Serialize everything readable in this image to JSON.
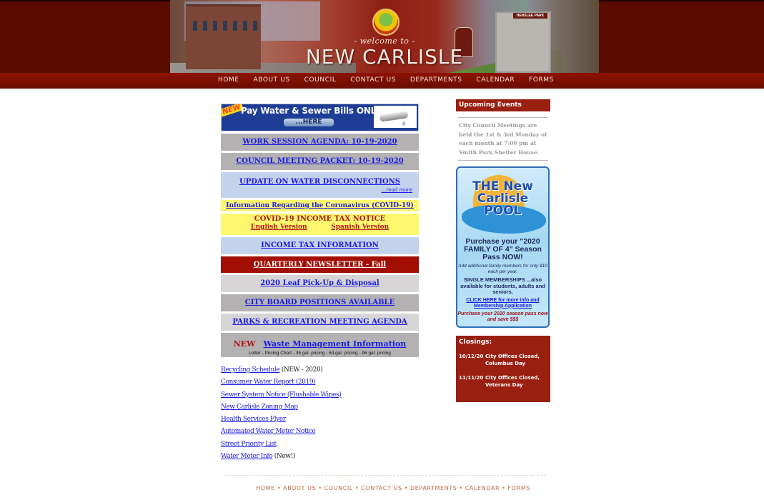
{
  "header": {
    "welcome": "- welcome to -",
    "title": "NEW CARLISLE",
    "sign_text": "HENSLEE PARK",
    "nav": [
      "HOME",
      "ABOUT US",
      "COUNCIL",
      "CONTACT US",
      "DEPARTMENTS",
      "CALENDAR",
      "FORMS"
    ]
  },
  "main": {
    "pay_banner": {
      "new_tag": "NEW",
      "text": "Pay Water & Sewer Bills ONLINE",
      "button": "...HERE"
    },
    "work_session": "WORK SESSION AGENDA: 10-19-2020",
    "council_packet": "COUNCIL MEETING PACKET: 10-19-2020",
    "water_disconnections": {
      "title": "UPDATE ON WATER DISCONNECTIONS",
      "read_more": "...read more"
    },
    "covid_info": "Information Regarding the Coronavirus (COVID-19)",
    "covid_tax": {
      "title": "COVID-19 INCOME TAX NOTICE",
      "english": "English Version",
      "spanish": "Spanish Version"
    },
    "income_tax": "INCOME TAX INFORMATION",
    "newsletter": "QUARTERLY NEWSLETTER - Fall",
    "leaf_pickup": "2020 Leaf Pick-Up & Disposal",
    "city_board": "CITY BOARD POSITIONS AVAILABLE",
    "parks_rec": "PARKS & RECREATION MEETING AGENDA",
    "waste": {
      "new_label": "NEW",
      "title": "Waste Management Information",
      "links": [
        "Letter",
        "Pricing Chart",
        "35 gal. pricing",
        "64 gal. pricing",
        "96 gal. pricing"
      ],
      "separator": " - "
    },
    "documents": [
      {
        "link": "Recycling Schedule",
        "note": " (NEW - 2020)"
      },
      {
        "link": "Consumer Water Report (2019)",
        "note": ""
      },
      {
        "link": "Sewer System Notice (Flushable Wipes)",
        "note": ""
      },
      {
        "link": "New Carlisle Zoning Map",
        "note": ""
      },
      {
        "link": "Health Services Flyer",
        "note": ""
      },
      {
        "link": "Automated Water Meter Notice",
        "note": ""
      },
      {
        "link": "Street Priority List",
        "note": ""
      },
      {
        "link": "Water Meter Info",
        "note": " (New!)"
      }
    ]
  },
  "sidebar": {
    "events_title": "Upcoming Events",
    "events_text": "City Council Meetings are held the 1st & 3rd Monday of each month at 7:00 pm at Smith Park Shelter House.",
    "pool_ad": {
      "logo": [
        "THE New",
        "Carlisle",
        "POOL"
      ],
      "headline": "Purchase your \"2020 FAMILY OF 4\" Season Pass NOW!",
      "sub": "Add additional family members for only $10 each per year.",
      "single": "SINGLE MEMBERSHIPS ...also available for students, adults and seniors.",
      "click": "CLICK HERE for more info and Membership Application",
      "promo": "Purchase your 2020 season pass now and save $$$"
    },
    "closings_title": "Closings:",
    "closings": [
      {
        "date": "10/12/20",
        "text": "City Offices Closed, Columbus Day"
      },
      {
        "date": "11/11/20",
        "text": "City Offices Closed, Veterans Day"
      }
    ]
  },
  "footer": {
    "nav": [
      "HOME",
      "ABOUT US",
      "COUNCIL",
      "CONTACT US",
      "DEPARTMENTS",
      "CALENDAR",
      "FORMS"
    ],
    "separator": "•"
  },
  "colors": {
    "header_dark_red": "#5a0c00",
    "nav_red": "#8e1200",
    "sidebar_red": "#991f10",
    "link_blue": "#1a1ae6",
    "notice_red": "#b0151a",
    "yellow_box": "#fff86e",
    "blue_box": "#c3d3ec"
  }
}
